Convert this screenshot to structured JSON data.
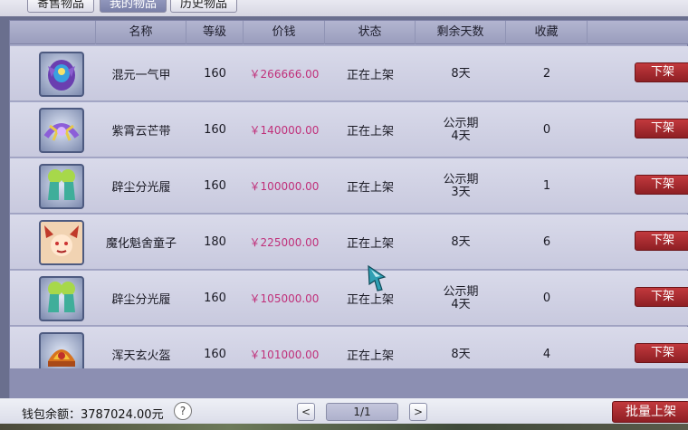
{
  "tabs": [
    {
      "label": "寄售物品",
      "active": false
    },
    {
      "label": "我的物品",
      "active": true
    },
    {
      "label": "历史物品",
      "active": false
    }
  ],
  "table": {
    "headers": [
      "",
      "名称",
      "等级",
      "价钱",
      "状态",
      "剩余天数",
      "收藏"
    ],
    "rows": [
      {
        "icon": "purple-armor-icon",
        "name": "混元一气甲",
        "level": "160",
        "price": "￥266666.00",
        "status": "正在上架",
        "days_line1": "8天",
        "days_line2": "",
        "favorites": "2",
        "action": "下架"
      },
      {
        "icon": "purple-belt-icon",
        "name": "紫霄云芒带",
        "level": "160",
        "price": "￥140000.00",
        "status": "正在上架",
        "days_line1": "公示期",
        "days_line2": "4天",
        "favorites": "0",
        "action": "下架"
      },
      {
        "icon": "green-boots-icon",
        "name": "辟尘分光履",
        "level": "160",
        "price": "￥100000.00",
        "status": "正在上架",
        "days_line1": "公示期",
        "days_line2": "3天",
        "favorites": "1",
        "action": "下架"
      },
      {
        "icon": "demon-child-icon",
        "name": "魔化魁舍童子",
        "level": "180",
        "price": "￥225000.00",
        "status": "正在上架",
        "days_line1": "8天",
        "days_line2": "",
        "favorites": "6",
        "action": "下架"
      },
      {
        "icon": "green-boots-icon",
        "name": "辟尘分光履",
        "level": "160",
        "price": "￥105000.00",
        "status": "正在上架",
        "days_line1": "公示期",
        "days_line2": "4天",
        "favorites": "0",
        "action": "下架"
      },
      {
        "icon": "fire-helmet-icon",
        "name": "浑天玄火盔",
        "level": "160",
        "price": "￥101000.00",
        "status": "正在上架",
        "days_line1": "8天",
        "days_line2": "",
        "favorites": "4",
        "action": "下架"
      }
    ]
  },
  "footer": {
    "wallet_label": "钱包余额：3787024.00元",
    "help_symbol": "?",
    "prev_symbol": "<",
    "next_symbol": ">",
    "page": "1/1",
    "batch_label": "批量上架"
  },
  "colors": {
    "price": "#c0307a",
    "delist_button": "#a8292e",
    "header_bg": "#a6a9c8"
  }
}
